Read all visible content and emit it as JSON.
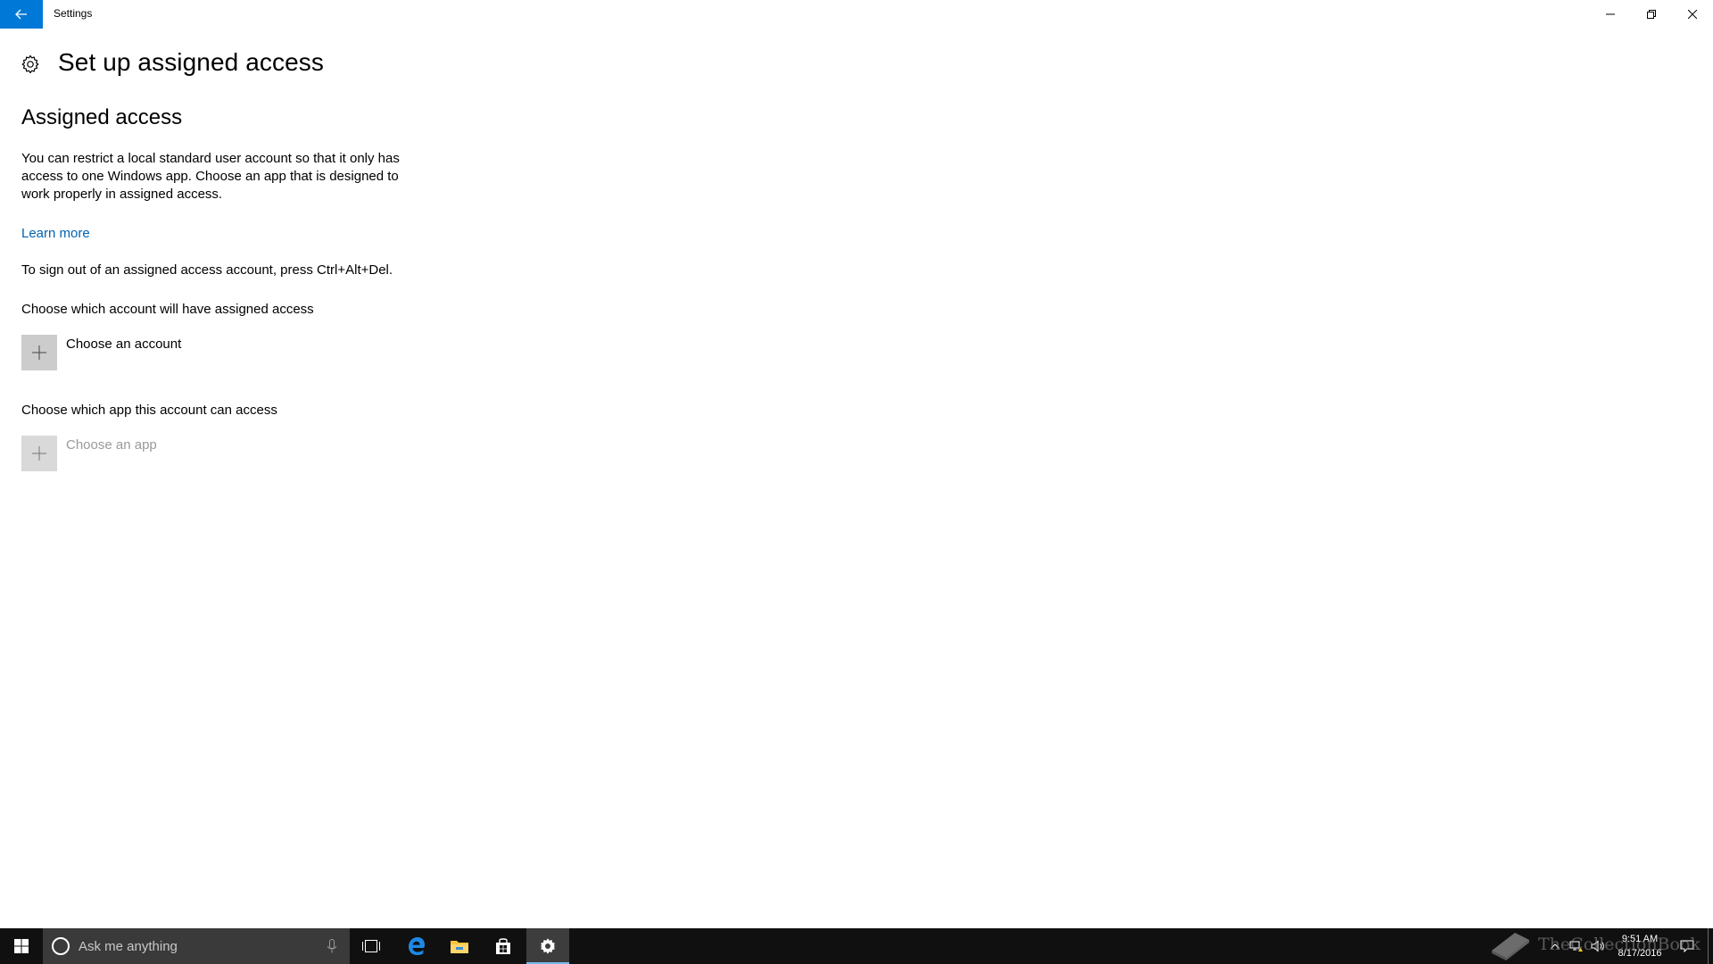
{
  "window": {
    "title": "Settings",
    "back_icon": "arrow-left-icon",
    "controls": [
      "minimize-icon",
      "restore-icon",
      "close-icon"
    ]
  },
  "page": {
    "icon": "gear-icon",
    "title": "Set up assigned access",
    "section_title": "Assigned access",
    "description": "You can restrict a local standard user account so that it only has access to one Windows app. Choose an app that is designed to work properly in assigned access.",
    "learn_more": "Learn more",
    "signout_note": "To sign out of an assigned access account, press Ctrl+Alt+Del.",
    "account": {
      "label": "Choose which account will have assigned access",
      "button": "Choose an account",
      "enabled": true
    },
    "app": {
      "label": "Choose which app this account can access",
      "button": "Choose an app",
      "enabled": false
    }
  },
  "taskbar": {
    "search_placeholder": "Ask me anything",
    "pinned": [
      "task-view-icon",
      "edge-icon",
      "file-explorer-icon",
      "store-icon",
      "settings-icon"
    ],
    "active_app": "Settings",
    "clock_time": "9:51 AM",
    "clock_date": "8/17/2016"
  },
  "watermark": {
    "text": "TheCollectionBook"
  },
  "colors": {
    "accent": "#0078d7",
    "link": "#0063b1",
    "taskbar": "#101010",
    "search_box": "#3a3a3a",
    "tile": "#cccccc"
  }
}
